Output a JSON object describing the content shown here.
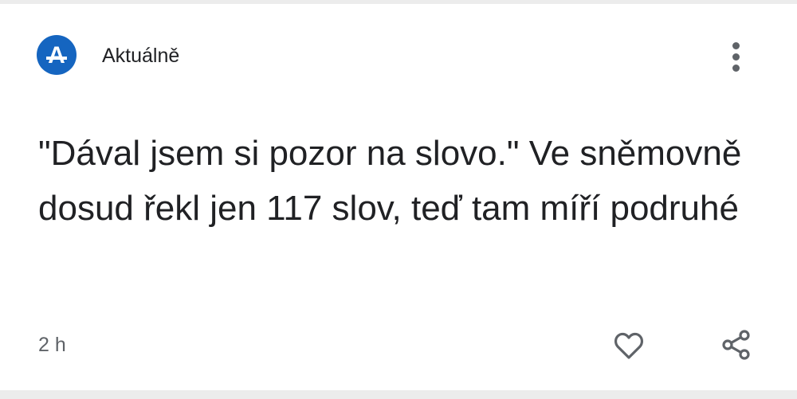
{
  "card": {
    "source": {
      "logo_icon": "aktualne-logo",
      "logo_letter": "A",
      "logo_color": "#1565c0",
      "name": "Aktuálně"
    },
    "menu_icon": "more-vert-icon",
    "headline": "\"Dával jsem si pozor na slovo.\" Ve sněmovně dosud řekl jen 117 slov, teď tam míří podruhé",
    "timestamp": "2 h",
    "actions": {
      "like_icon": "heart-outline-icon",
      "share_icon": "share-icon"
    }
  },
  "colors": {
    "text": "#202124",
    "secondary_text": "#5f6368",
    "icon": "#5f6368",
    "divider": "#ececec",
    "logo_background": "#1565c0"
  }
}
